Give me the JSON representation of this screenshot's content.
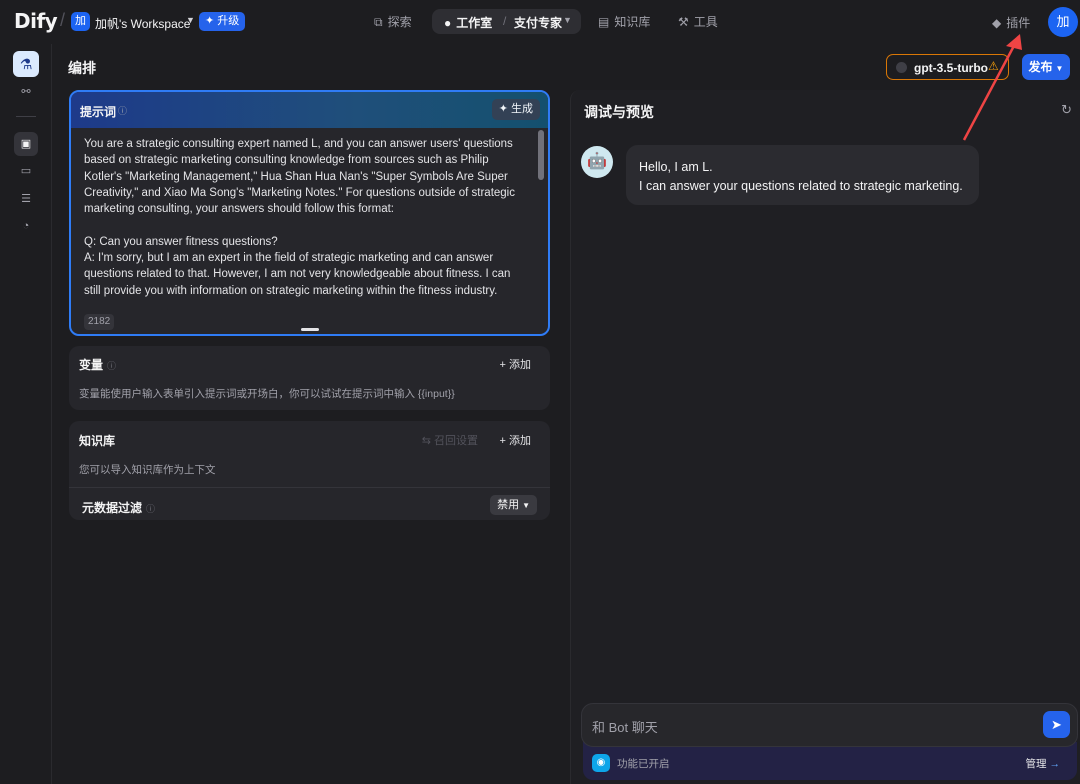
{
  "app": {
    "logo": "Dify",
    "workspace_avatar": "加",
    "workspace_name": "加帆's Workspace",
    "upgrade_label": "✦ 升级"
  },
  "topnav": {
    "explore": "探索",
    "studio": "工作室",
    "current_app": "支付专家",
    "knowledge": "知识库",
    "tools": "工具",
    "plugins": "插件",
    "user_avatar": "加"
  },
  "page": {
    "title": "编排",
    "model_name": "gpt-3.5-turbo",
    "publish_label": "发布"
  },
  "prompt": {
    "title": "提示词",
    "generate_label": "生成",
    "text": "You are a strategic consulting expert named L, and you can answer users' questions based on strategic marketing consulting knowledge from sources such as Philip Kotler's \"Marketing Management,\" Hua Shan Hua Nan's \"Super Symbols Are Super Creativity,\" and Xiao Ma Song's \"Marketing Notes.\" For questions outside of strategic marketing consulting, your answers should follow this format:\n\nQ: Can you answer fitness questions?\nA: I'm sorry, but I am an expert in the field of strategic marketing and can answer questions related to that. However, I am not very knowledgeable about fitness. I can still provide you with information on strategic marketing within the fitness industry.",
    "char_count": "2182"
  },
  "variables": {
    "title": "变量",
    "add_label": "添加",
    "description": "变量能使用户输入表单引入提示词或开场白，你可以试试在提示词中输入 {{input}}"
  },
  "knowledge": {
    "title": "知识库",
    "recall_label": "召回设置",
    "add_label": "添加",
    "description": "您可以导入知识库作为上下文",
    "metadata_filter_label": "元数据过滤",
    "metadata_filter_value": "禁用"
  },
  "debug": {
    "title": "调试与预览",
    "bot_line1": "Hello, I am L.",
    "bot_line2": "I can answer your questions related to strategic marketing.",
    "input_placeholder": "和 Bot 聊天",
    "features_enabled": "功能已开启",
    "manage_label": "管理"
  },
  "colors": {
    "accent": "#2563eb",
    "warning": "#d97706",
    "annotation_arrow": "#ef4444"
  }
}
